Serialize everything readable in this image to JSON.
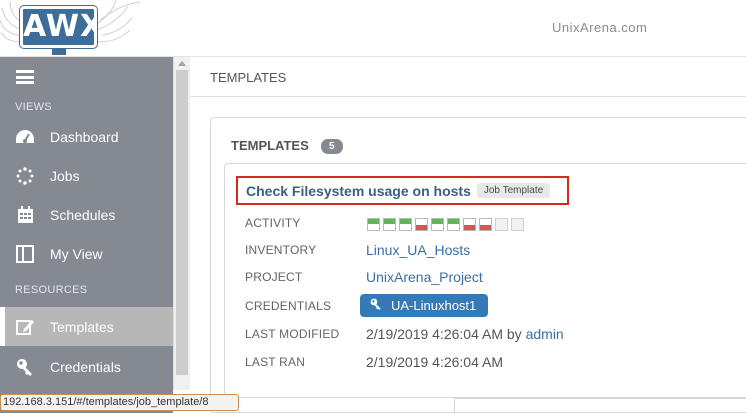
{
  "header": {
    "logo_text": "AWX",
    "site_name": "UnixArena.com"
  },
  "sidebar": {
    "section_views": "VIEWS",
    "section_resources": "RESOURCES",
    "items": [
      {
        "label": "Dashboard",
        "icon": "dashboard-icon"
      },
      {
        "label": "Jobs",
        "icon": "jobs-icon"
      },
      {
        "label": "Schedules",
        "icon": "calendar-icon"
      },
      {
        "label": "My View",
        "icon": "my-view-icon"
      },
      {
        "label": "Templates",
        "icon": "edit-icon",
        "active": true
      },
      {
        "label": "Credentials",
        "icon": "key-icon"
      }
    ]
  },
  "main": {
    "breadcrumb": "TEMPLATES",
    "panel_title": "TEMPLATES",
    "count": "5"
  },
  "template": {
    "name": "Check Filesystem usage on hosts",
    "type": "Job Template",
    "labels": {
      "activity": "ACTIVITY",
      "inventory": "INVENTORY",
      "project": "PROJECT",
      "credentials": "CREDENTIALS",
      "last_modified": "LAST MODIFIED",
      "last_ran": "LAST RAN"
    },
    "activity": [
      "success",
      "success",
      "success",
      "failed",
      "success",
      "success",
      "failed",
      "failed",
      "none",
      "none"
    ],
    "inventory": "Linux_UA_Hosts",
    "project": "UnixArena_Project",
    "credential": "UA-Linuxhost1",
    "last_modified": "2/19/2019 4:26:04 AM",
    "last_modified_by_word": "by",
    "last_modified_user": "admin",
    "last_ran": "2/19/2019 4:26:04 AM"
  },
  "status_bar": {
    "url": "192.168.3.151/#/templates/job_template/8"
  },
  "colors": {
    "sidebar_bg": "#848992",
    "link": "#3a6fa6",
    "highlight_border": "#d52b1e",
    "success": "#5cb85c",
    "failed": "#d9534f",
    "credential_pill": "#337ab7"
  }
}
